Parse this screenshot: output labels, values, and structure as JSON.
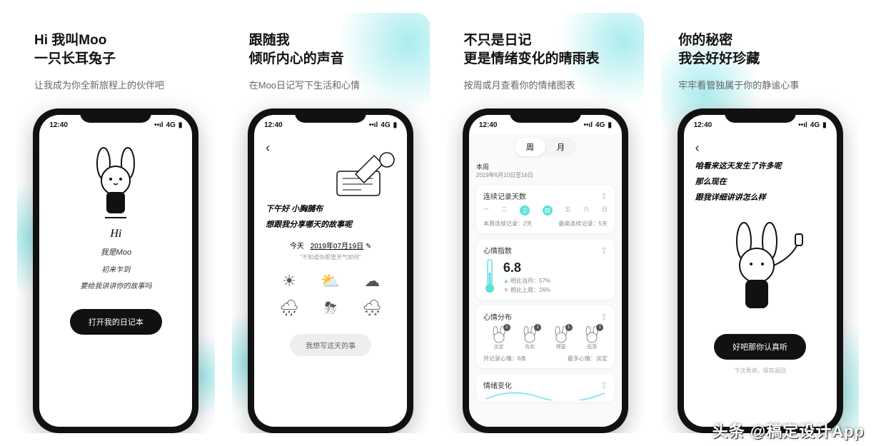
{
  "status": {
    "time": "12:40",
    "net": "4G"
  },
  "watermark": "头条 @稿定设计App",
  "cards": [
    {
      "title1": "Hi 我叫Moo",
      "title2": "一只长耳兔子",
      "subtitle": "让我成为你全新旅程上的伙伴吧",
      "screen": {
        "hi": "Hi",
        "l1": "我是Moo",
        "l2": "初来乍到",
        "l3": "要给我讲讲你的故事吗",
        "button": "打开我的日记本"
      }
    },
    {
      "title1": "跟随我",
      "title2": "倾听内心的声音",
      "subtitle": "在Moo日记写下生活和心情",
      "screen": {
        "greet": "下午好 小胸脯布",
        "ask": "想跟我分享哪天的故事呢",
        "today_label": "今天",
        "today_date": "2019年07月19日",
        "edit_icon": "✎",
        "hint": "\"不知道你那里天气如何\"",
        "button": "我想写这天的事"
      }
    },
    {
      "title1": "不只是日记",
      "title2": "更是情绪变化的晴雨表",
      "subtitle": "按周或月查看你的情绪图表",
      "screen": {
        "seg_week": "周",
        "seg_month": "月",
        "this_week": "本周",
        "date_range": "2019年6月10日至16日",
        "panel1_title": "连续记录天数",
        "days": [
          "一",
          "二",
          "三",
          "四",
          "五",
          "六",
          "日"
        ],
        "streak_label": "本周连续记录：",
        "streak_val": "2天",
        "best_label": "最高连续记录：",
        "best_val": "5天",
        "panel2_title": "心情指数",
        "mood_score": "6.8",
        "vs_month": "相比当月：57%",
        "vs_week": "相比上周：26%",
        "panel3_title": "心情分布",
        "dist": [
          {
            "label": "淡定",
            "n": "2"
          },
          {
            "label": "充实",
            "n": "1"
          },
          {
            "label": "得瑟",
            "n": "1"
          },
          {
            "label": "低落",
            "n": "1"
          }
        ],
        "total_label": "共记录心情：",
        "total_val": "8条",
        "most_label": "最多心情：",
        "most_val": "淡定",
        "panel4_title": "情绪变化"
      }
    },
    {
      "title1": "你的秘密",
      "title2": "我会好好珍藏",
      "subtitle": "牢牢看管独属于你的静谧心事",
      "screen": {
        "l1": "咱看来这天发生了许多呢",
        "l2": "那么现在",
        "l3": "跟我详细讲讲怎么样",
        "button": "好吧那你认真听",
        "hint": "下次再讲，保存返回"
      }
    }
  ]
}
